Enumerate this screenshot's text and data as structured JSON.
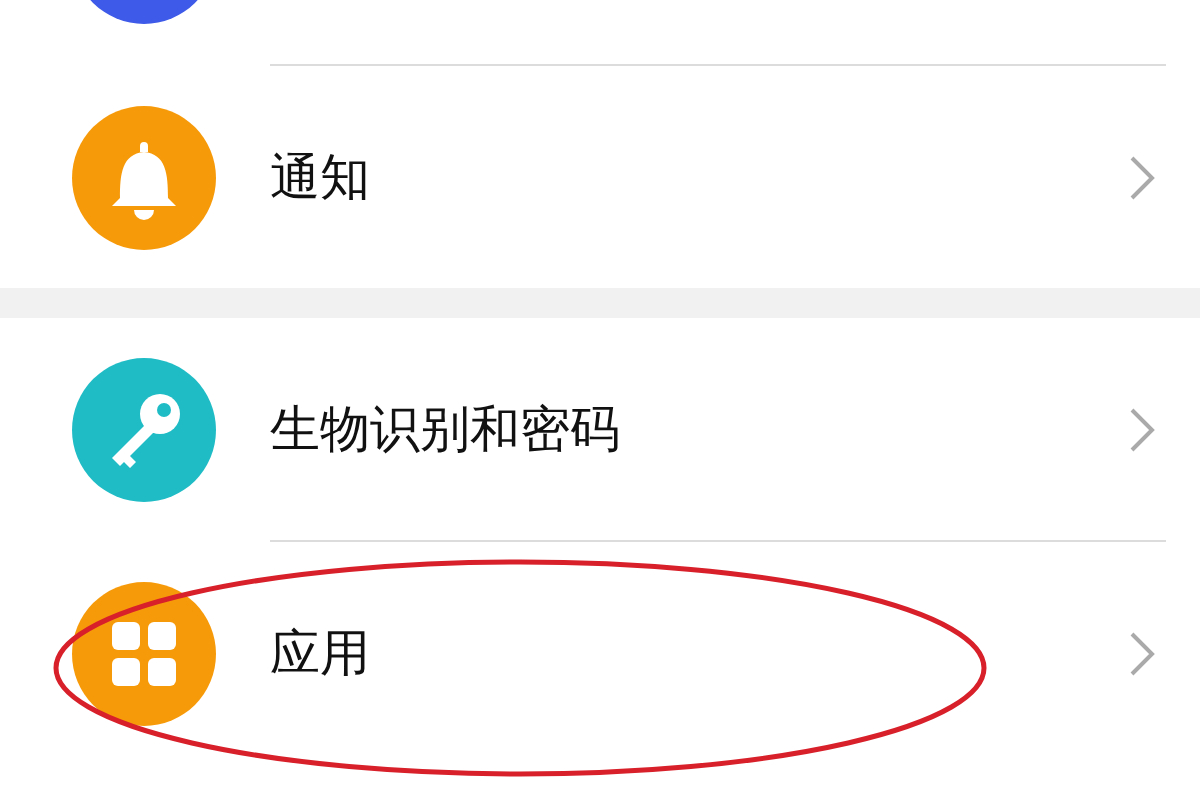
{
  "groups": [
    {
      "items": [
        {
          "kind": "stub",
          "color": "#3d5ae8"
        },
        {
          "kind": "bell",
          "color": "#f79a0a",
          "label": "通知",
          "circled": false
        }
      ]
    },
    {
      "items": [
        {
          "kind": "key",
          "color": "#1fbcc6",
          "label": "生物识别和密码",
          "circled": false
        },
        {
          "kind": "apps",
          "color": "#f79a0a",
          "label": "应用",
          "circled": true
        }
      ]
    }
  ]
}
